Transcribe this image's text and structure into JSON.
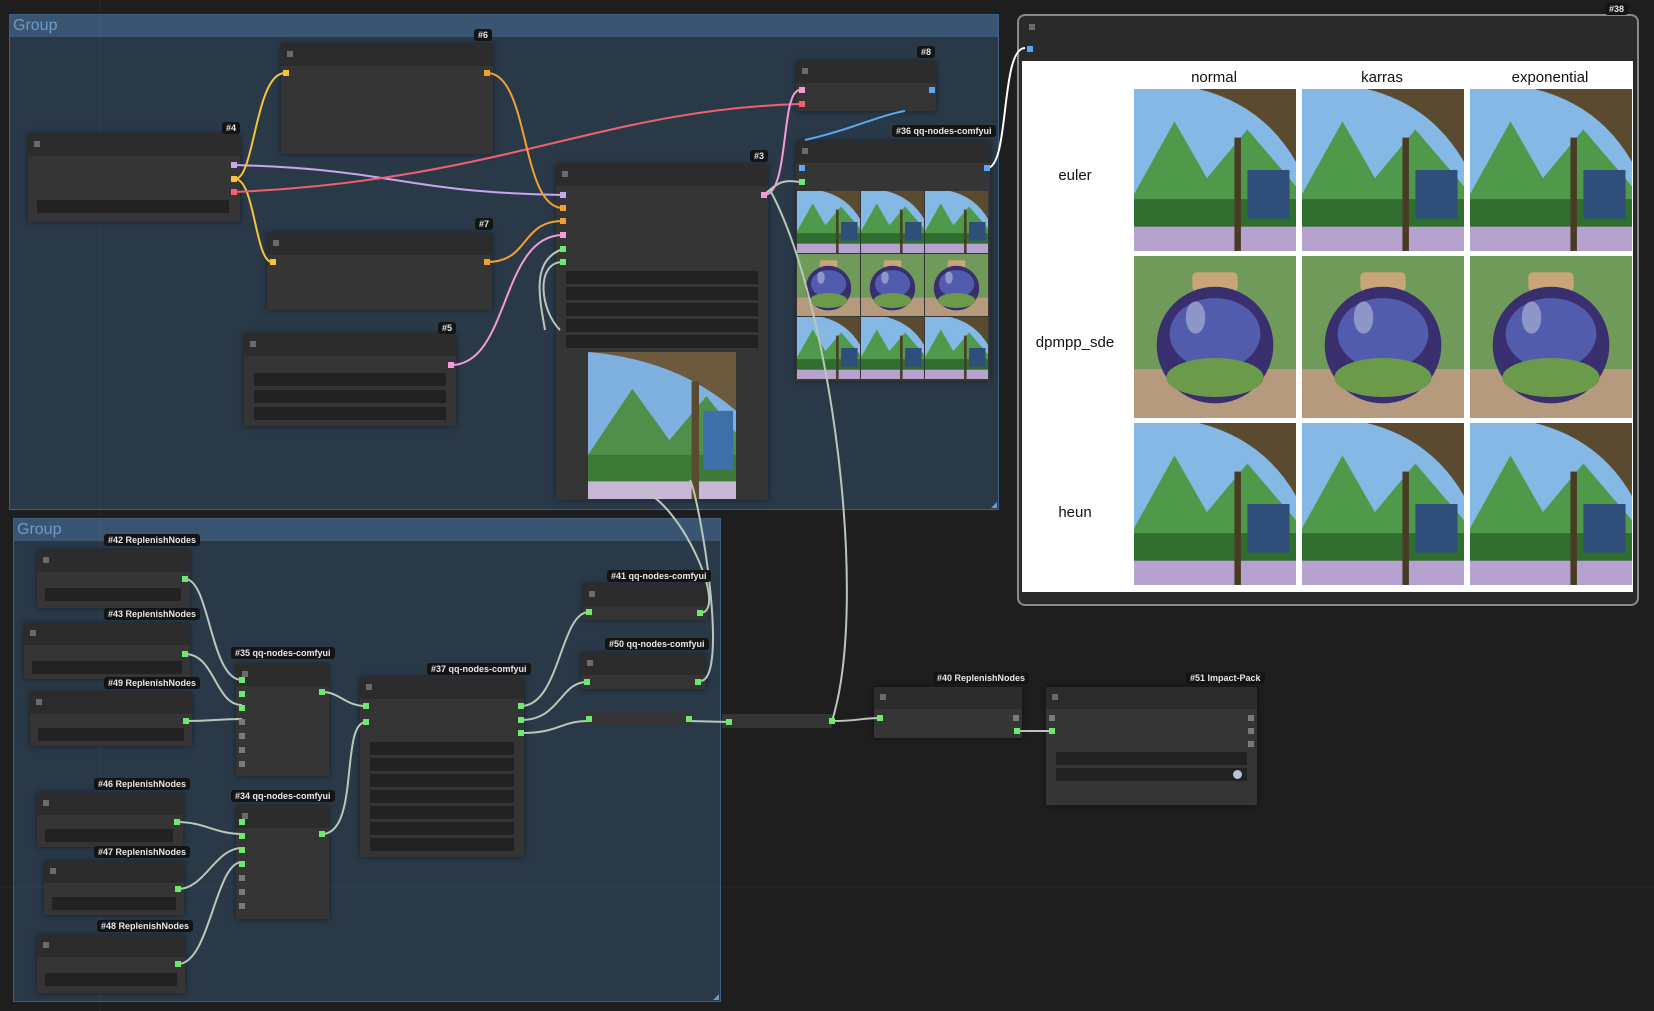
{
  "groups": [
    {
      "id": "group-top",
      "title": "Group"
    },
    {
      "id": "group-bottom",
      "title": "Group"
    }
  ],
  "nodes": {
    "n4": {
      "badge": "#4"
    },
    "n6": {
      "badge": "#6"
    },
    "n7": {
      "badge": "#7"
    },
    "n5": {
      "badge": "#5"
    },
    "n3": {
      "badge": "#3"
    },
    "n8": {
      "badge": "#8"
    },
    "n36": {
      "badge": "#36 qq-nodes-comfyui"
    },
    "n38": {
      "badge": "#38"
    },
    "n42": {
      "badge": "#42 ReplenishNodes"
    },
    "n43": {
      "badge": "#43 ReplenishNodes"
    },
    "n49": {
      "badge": "#49 ReplenishNodes"
    },
    "n46": {
      "badge": "#46 ReplenishNodes"
    },
    "n47": {
      "badge": "#47 ReplenishNodes"
    },
    "n48": {
      "badge": "#48 ReplenishNodes"
    },
    "n35": {
      "badge": "#35 qq-nodes-comfyui"
    },
    "n34": {
      "badge": "#34 qq-nodes-comfyui"
    },
    "n37": {
      "badge": "#37 qq-nodes-comfyui"
    },
    "n41": {
      "badge": "#41 qq-nodes-comfyui"
    },
    "n50": {
      "badge": "#50 qq-nodes-comfyui"
    },
    "n40": {
      "badge": "#40 ReplenishNodes"
    },
    "n51": {
      "badge": "#51 Impact-Pack"
    }
  },
  "xy_grid": {
    "columns": [
      "normal",
      "karras",
      "exponential"
    ],
    "rows": [
      "euler",
      "dpmpp_sde",
      "heun"
    ]
  },
  "colors": {
    "canvas": "#1e1e1e",
    "group_fill": "#3a5c7d",
    "node_body": "#353535",
    "wire_clip": "#f6c33b",
    "wire_vae": "#f06070",
    "wire_model": "#c9a6f0",
    "wire_latent": "#f59ad9",
    "wire_int": "#6fe86f",
    "wire_image": "#5aa8f0"
  }
}
